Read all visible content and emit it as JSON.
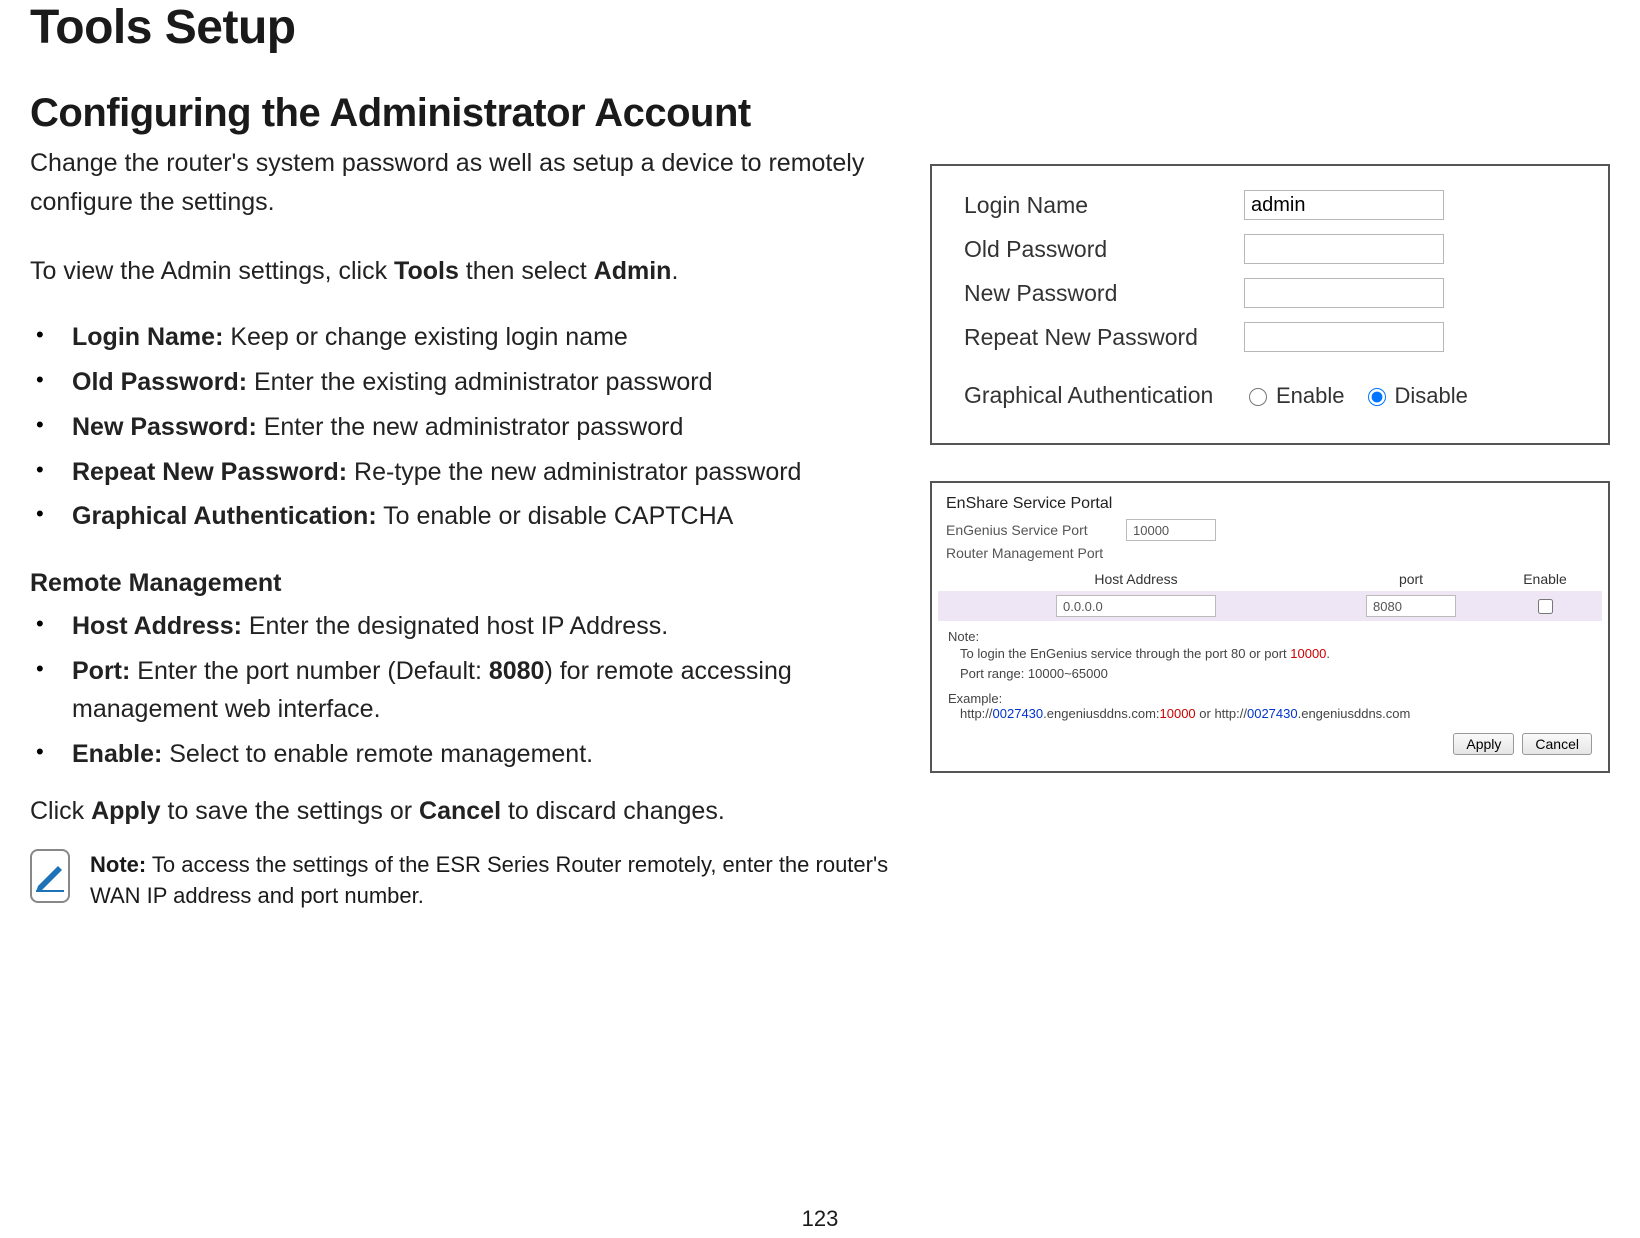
{
  "page_number": "123",
  "titles": {
    "main": "Tools Setup",
    "section": "Configuring the Administrator Account"
  },
  "intro": {
    "p1": "Change the router's system password as well as setup a device to remotely configure the settings.",
    "p2_pre": "To view the Admin settings, click ",
    "p2_bold1": "Tools",
    "p2_mid": " then select ",
    "p2_bold2": "Admin",
    "p2_post": "."
  },
  "bullets_main": [
    {
      "label": "Login Name:",
      "text": " Keep or change existing login name"
    },
    {
      "label": "Old Password:",
      "text": " Enter the existing administrator password"
    },
    {
      "label": "New Password:",
      "text": " Enter the new administrator password"
    },
    {
      "label": "Repeat New Password:",
      "text": " Re-type the new administrator password"
    },
    {
      "label": "Graphical Authentication:",
      "text": " To enable or disable  CAPTCHA"
    }
  ],
  "remote": {
    "heading": "Remote Management",
    "items": [
      {
        "label": "Host Address:",
        "text": " Enter the designated host IP Address."
      },
      {
        "label": "Port:",
        "text_pre": " Enter the port number (Default: ",
        "bold": "8080",
        "text_post": ") for remote accessing",
        "cont": "management web interface."
      },
      {
        "label": "Enable:",
        "text": " Select to enable remote management."
      }
    ]
  },
  "apply_line": {
    "pre": "Click ",
    "b1": "Apply",
    "mid": " to save the settings or ",
    "b2": "Cancel",
    "post": " to discard changes."
  },
  "note": {
    "label": "Note:",
    "text": " To access the settings of the ESR Series Router remotely, enter the router's WAN IP address and port number."
  },
  "panel1": {
    "rows": {
      "login_name": {
        "label": "Login Name",
        "value": "admin"
      },
      "old_pw": {
        "label": "Old Password",
        "value": ""
      },
      "new_pw": {
        "label": "New Password",
        "value": ""
      },
      "rpt_pw": {
        "label": "Repeat New Password",
        "value": ""
      }
    },
    "ga": {
      "label": "Graphical Authentication",
      "enable": "Enable",
      "disable": "Disable",
      "selected": "disable"
    }
  },
  "panel2": {
    "title": "EnShare Service Portal",
    "service_port": {
      "label": "EnGenius Service Port",
      "value": "10000"
    },
    "mgmt_label": "Router Management Port",
    "headers": {
      "host": "Host Address",
      "port": "port",
      "enable": "Enable"
    },
    "row": {
      "host": "0.0.0.0",
      "port": "8080",
      "enabled": false
    },
    "note_label": "Note:",
    "note_line1_pre": "To login the EnGenius service through the port 80 or port ",
    "note_line1_red": "10000",
    "note_line1_post": ".",
    "note_line2": "Port range: 10000~65000",
    "example_label": "Example:",
    "example_pre1": "http://",
    "example_blue1": "0027430",
    "example_mid1": ".engeniusddns.com:",
    "example_red": "10000",
    "example_or": " or http://",
    "example_blue2": "0027430",
    "example_post": ".engeniusddns.com",
    "buttons": {
      "apply": "Apply",
      "cancel": "Cancel"
    }
  }
}
